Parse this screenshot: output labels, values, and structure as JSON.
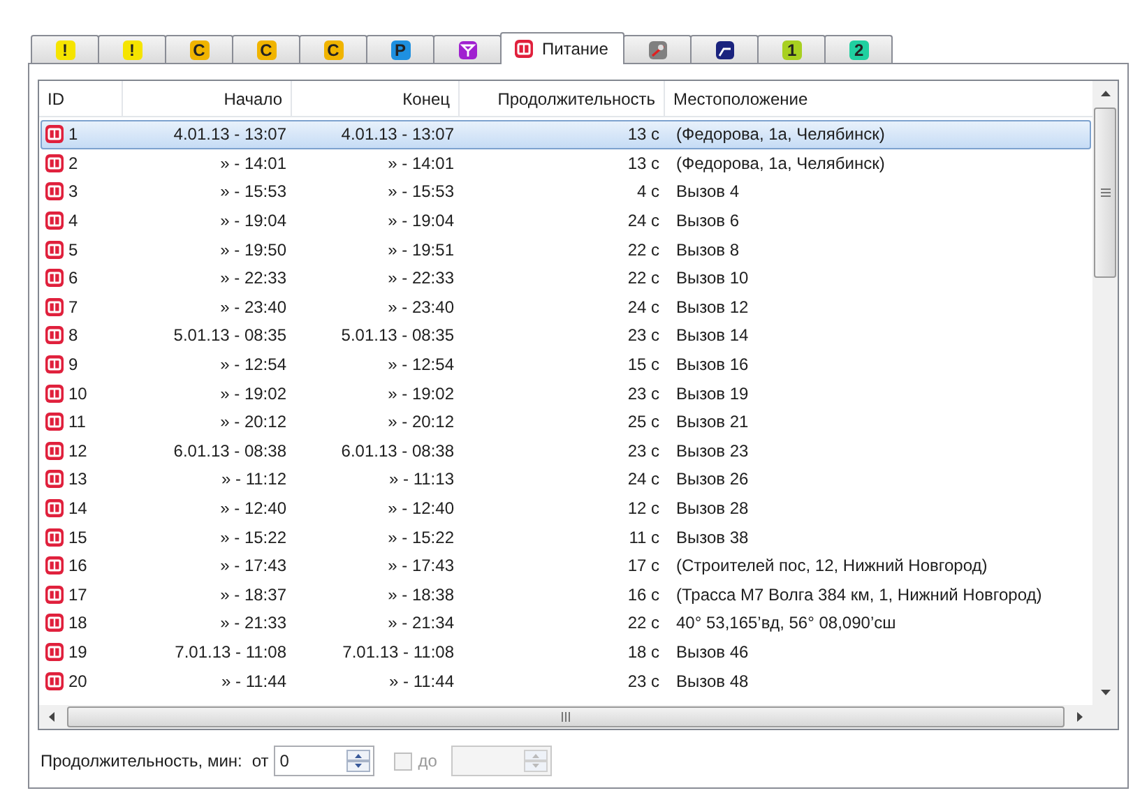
{
  "tabs": [
    {
      "kind": "letter",
      "icon_text": "!",
      "color": "#f5e400",
      "selected": false
    },
    {
      "kind": "letter",
      "icon_text": "!",
      "color": "#f5e400",
      "selected": false
    },
    {
      "kind": "letter",
      "icon_text": "C",
      "color": "#f0b400",
      "selected": false
    },
    {
      "kind": "letter",
      "icon_text": "C",
      "color": "#f0b400",
      "selected": false
    },
    {
      "kind": "letter",
      "icon_text": "C",
      "color": "#f0b400",
      "selected": false
    },
    {
      "kind": "letter",
      "icon_text": "P",
      "color": "#1e90e0",
      "selected": false
    },
    {
      "kind": "antenna",
      "color": "#a020d0",
      "selected": false
    },
    {
      "kind": "power",
      "color": "#e0203c",
      "label": "Питание",
      "selected": true
    },
    {
      "kind": "gauge",
      "color": "#808080",
      "selected": false
    },
    {
      "kind": "graph",
      "color": "#1a237e",
      "selected": false
    },
    {
      "kind": "letter",
      "icon_text": "1",
      "color": "#a8d020",
      "selected": false
    },
    {
      "kind": "letter",
      "icon_text": "2",
      "color": "#20d0a0",
      "selected": false
    }
  ],
  "table": {
    "columns": [
      "ID",
      "Начало",
      "Конец",
      "Продолжительность",
      "Местоположение"
    ],
    "rows": [
      {
        "id": "1",
        "start": "4.01.13 - 13:07",
        "end": "4.01.13 - 13:07",
        "duration": "13 с",
        "location": "(Федорова, 1а, Челябинск)",
        "selected": true
      },
      {
        "id": "2",
        "start": "» - 14:01",
        "end": "» - 14:01",
        "duration": "13 с",
        "location": "(Федорова, 1а, Челябинск)",
        "selected": false
      },
      {
        "id": "3",
        "start": "» - 15:53",
        "end": "» - 15:53",
        "duration": "4 с",
        "location": "Вызов 4",
        "selected": false
      },
      {
        "id": "4",
        "start": "» - 19:04",
        "end": "» - 19:04",
        "duration": "24 с",
        "location": "Вызов 6",
        "selected": false
      },
      {
        "id": "5",
        "start": "» - 19:50",
        "end": "» - 19:51",
        "duration": "22 с",
        "location": "Вызов 8",
        "selected": false
      },
      {
        "id": "6",
        "start": "» - 22:33",
        "end": "» - 22:33",
        "duration": "22 с",
        "location": "Вызов 10",
        "selected": false
      },
      {
        "id": "7",
        "start": "» - 23:40",
        "end": "» - 23:40",
        "duration": "24 с",
        "location": "Вызов 12",
        "selected": false
      },
      {
        "id": "8",
        "start": "5.01.13 - 08:35",
        "end": "5.01.13 - 08:35",
        "duration": "23 с",
        "location": "Вызов 14",
        "selected": false
      },
      {
        "id": "9",
        "start": "» - 12:54",
        "end": "» - 12:54",
        "duration": "15 с",
        "location": "Вызов 16",
        "selected": false
      },
      {
        "id": "10",
        "start": "» - 19:02",
        "end": "» - 19:02",
        "duration": "23 с",
        "location": "Вызов 19",
        "selected": false
      },
      {
        "id": "11",
        "start": "» - 20:12",
        "end": "» - 20:12",
        "duration": "25 с",
        "location": "Вызов 21",
        "selected": false
      },
      {
        "id": "12",
        "start": "6.01.13 - 08:38",
        "end": "6.01.13 - 08:38",
        "duration": "23 с",
        "location": "Вызов 23",
        "selected": false
      },
      {
        "id": "13",
        "start": "» - 11:12",
        "end": "» - 11:13",
        "duration": "24 с",
        "location": "Вызов 26",
        "selected": false
      },
      {
        "id": "14",
        "start": "» - 12:40",
        "end": "» - 12:40",
        "duration": "12 с",
        "location": "Вызов 28",
        "selected": false
      },
      {
        "id": "15",
        "start": "» - 15:22",
        "end": "» - 15:22",
        "duration": "11 с",
        "location": "Вызов 38",
        "selected": false
      },
      {
        "id": "16",
        "start": "» - 17:43",
        "end": "» - 17:43",
        "duration": "17 с",
        "location": "(Строителей пос, 12, Нижний Новгород)",
        "selected": false
      },
      {
        "id": "17",
        "start": "» - 18:37",
        "end": "» - 18:38",
        "duration": "16 с",
        "location": "(Трасса М7 Волга 384 км, 1, Нижний Новгород)",
        "selected": false
      },
      {
        "id": "18",
        "start": "» - 21:33",
        "end": "» - 21:34",
        "duration": "22 с",
        "location": "40° 53,165’вд, 56° 08,090’сш",
        "selected": false
      },
      {
        "id": "19",
        "start": "7.01.13 - 11:08",
        "end": "7.01.13 - 11:08",
        "duration": "18 с",
        "location": "Вызов 46",
        "selected": false
      },
      {
        "id": "20",
        "start": "» - 11:44",
        "end": "» - 11:44",
        "duration": "23 с",
        "location": "Вызов 48",
        "selected": false
      }
    ]
  },
  "filter": {
    "label": "Продолжительность, мин:",
    "from_label": "от",
    "from_value": "0",
    "to_label": "до",
    "to_checked": false,
    "to_disabled": true
  }
}
